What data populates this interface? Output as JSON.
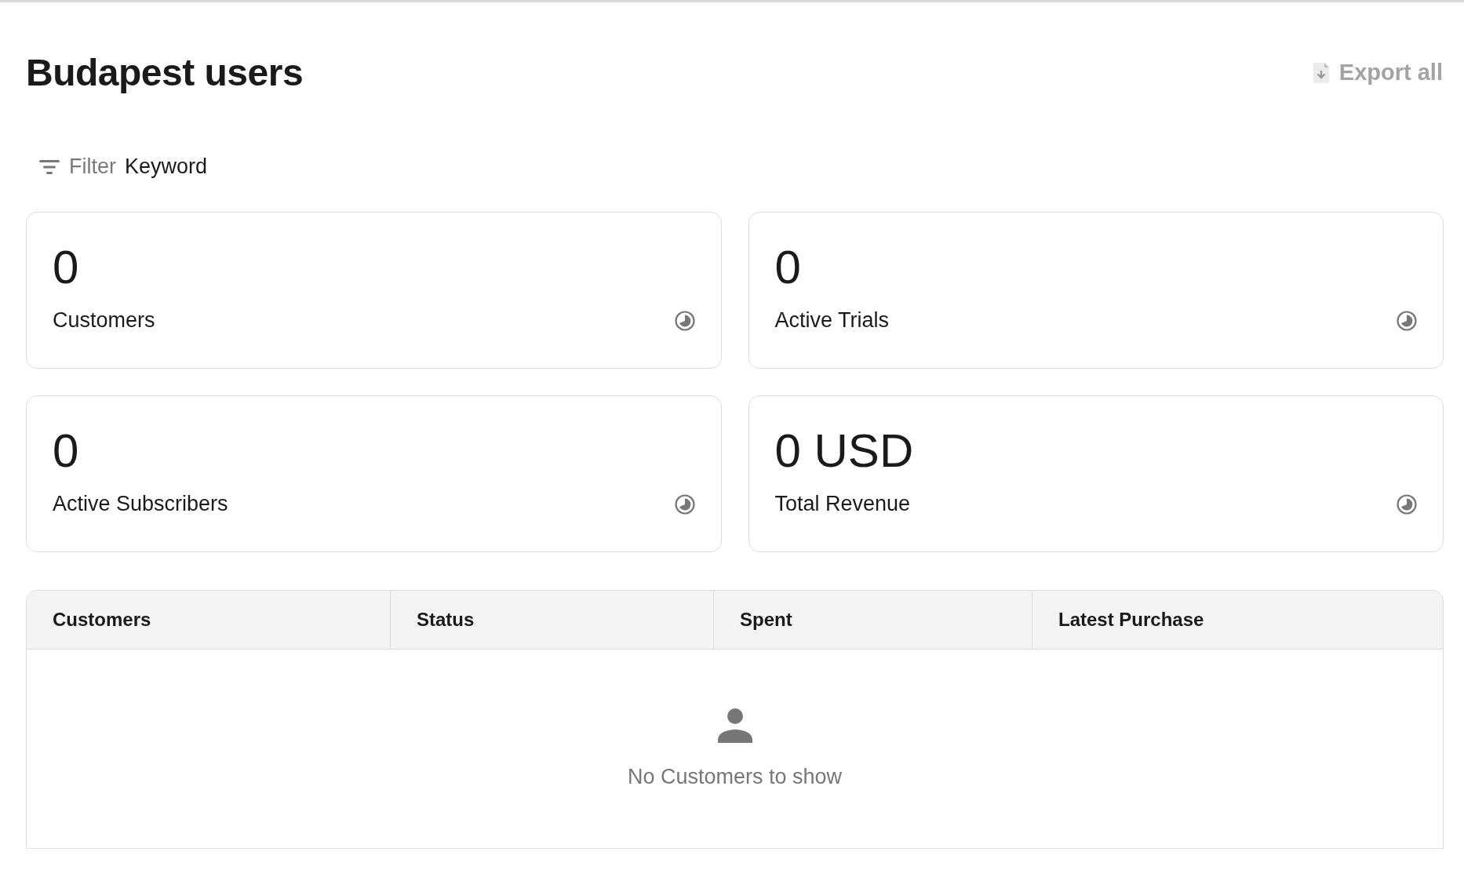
{
  "title": "Budapest users",
  "export": {
    "label": "Export all",
    "disabled": true
  },
  "filter": {
    "label": "Filter",
    "value": "Keyword"
  },
  "stats": [
    {
      "value": "0",
      "label": "Customers"
    },
    {
      "value": "0",
      "label": "Active Trials"
    },
    {
      "value": "0",
      "label": "Active Subscribers"
    },
    {
      "value": "0 USD",
      "label": "Total Revenue"
    }
  ],
  "table": {
    "columns": [
      "Customers",
      "Status",
      "Spent",
      "Latest Purchase"
    ],
    "empty_message": "No Customers to show"
  }
}
